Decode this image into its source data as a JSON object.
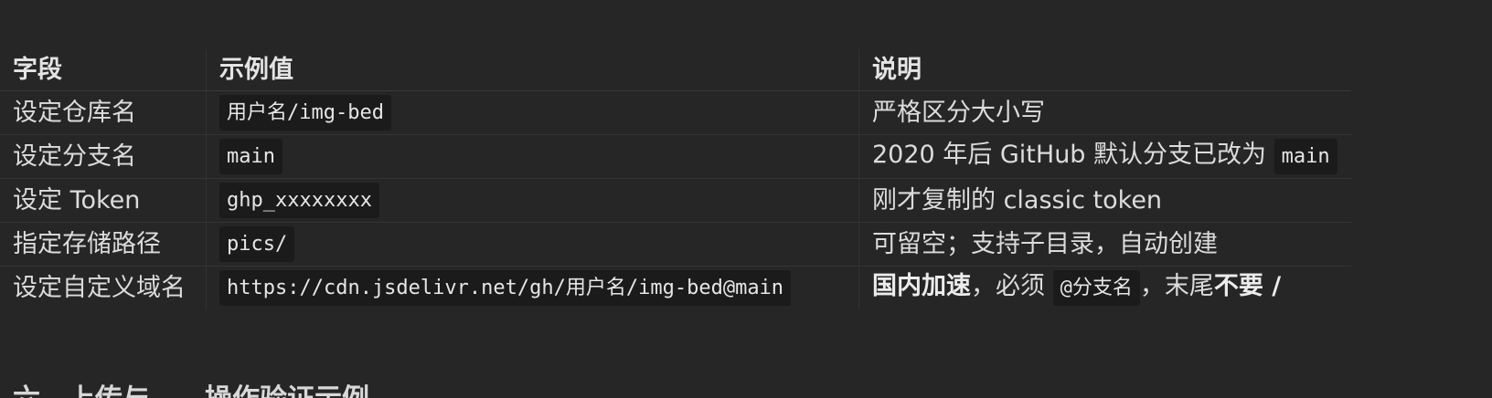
{
  "table": {
    "headers": [
      "字段",
      "示例值",
      "说明"
    ],
    "rows": [
      {
        "field": "设定仓库名",
        "example": "用户名/img-bed",
        "desc": "严格区分大小写"
      },
      {
        "field": "设定分支名",
        "example": "main",
        "desc_text": "2020 年后 GitHub 默认分支已改为 ",
        "desc_code": "main"
      },
      {
        "field": "设定 Token",
        "example": "ghp_xxxxxxxx",
        "desc": "刚才复制的 classic token"
      },
      {
        "field": "指定存储路径",
        "example": "pics/",
        "desc": "可留空；支持子目录，自动创建"
      },
      {
        "field": "设定自定义域名",
        "example": "https://cdn.jsdelivr.net/gh/用户名/img-bed@main",
        "desc_bold1": "国内加速",
        "desc_text1": "，必须 ",
        "desc_code": "@分支名",
        "desc_text2": "，末尾",
        "desc_bold2": "不要 /"
      }
    ]
  },
  "next_heading": "六、上传与……操作验证示例"
}
